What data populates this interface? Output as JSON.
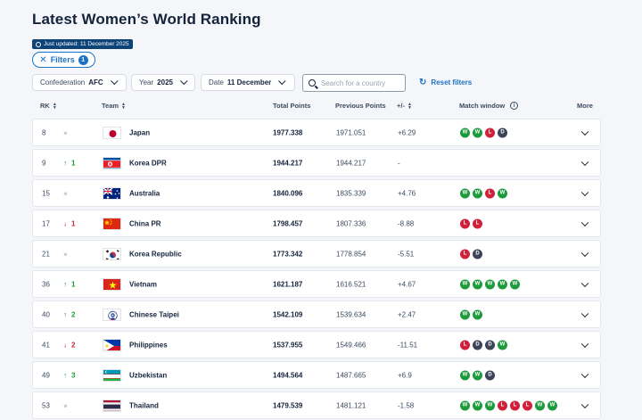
{
  "page": {
    "title": "Latest Women’s World Ranking",
    "updated": "Just updated: 11 December 2025"
  },
  "filters": {
    "label": "Filters",
    "count": "1",
    "close_glyph": "✕"
  },
  "dropdowns": {
    "confederation": {
      "label": "Confederation",
      "value": "AFC"
    },
    "year": {
      "label": "Year",
      "value": "2025"
    },
    "date": {
      "label": "Date",
      "value": "11 December"
    }
  },
  "search": {
    "placeholder": "Search for a country"
  },
  "reset": {
    "label": "Reset filters",
    "glyph": "↻"
  },
  "columns": {
    "rk": "RK",
    "team": "Team",
    "total": "Total Points",
    "previous": "Previous Points",
    "plusminus": "+/-",
    "match_window": "Match window",
    "more": "More",
    "info_glyph": "i"
  },
  "colors": {
    "win": "#1d9a3c",
    "loss": "#d0213a",
    "draw": "#3a4456",
    "accent": "#1a73c9"
  },
  "rows": [
    {
      "rk": "8",
      "move": "",
      "dir": "none",
      "team": "Japan",
      "flag": "japan",
      "total": "1977.338",
      "prev": "1971.051",
      "pm": "+6.29",
      "mw": [
        "W",
        "W",
        "L",
        "D"
      ]
    },
    {
      "rk": "9",
      "move": "1",
      "dir": "up",
      "team": "Korea DPR",
      "flag": "korea-dpr",
      "total": "1944.217",
      "prev": "1944.217",
      "pm": "-",
      "mw": []
    },
    {
      "rk": "15",
      "move": "",
      "dir": "none",
      "team": "Australia",
      "flag": "australia",
      "total": "1840.096",
      "prev": "1835.339",
      "pm": "+4.76",
      "mw": [
        "W",
        "W",
        "L",
        "W"
      ]
    },
    {
      "rk": "17",
      "move": "1",
      "dir": "down",
      "team": "China PR",
      "flag": "china",
      "total": "1798.457",
      "prev": "1807.336",
      "pm": "-8.88",
      "mw": [
        "L",
        "L"
      ]
    },
    {
      "rk": "21",
      "move": "",
      "dir": "none",
      "team": "Korea Republic",
      "flag": "korea-rep",
      "total": "1773.342",
      "prev": "1778.854",
      "pm": "-5.51",
      "mw": [
        "L",
        "D"
      ]
    },
    {
      "rk": "36",
      "move": "1",
      "dir": "up",
      "team": "Vietnam",
      "flag": "vietnam",
      "total": "1621.187",
      "prev": "1616.521",
      "pm": "+4.67",
      "mw": [
        "W",
        "W",
        "W",
        "W",
        "W"
      ]
    },
    {
      "rk": "40",
      "move": "2",
      "dir": "up",
      "team": "Chinese Taipei",
      "flag": "taipei",
      "total": "1542.109",
      "prev": "1539.634",
      "pm": "+2.47",
      "mw": [
        "W",
        "W"
      ]
    },
    {
      "rk": "41",
      "move": "2",
      "dir": "down",
      "team": "Philippines",
      "flag": "philippines",
      "total": "1537.955",
      "prev": "1549.466",
      "pm": "-11.51",
      "mw": [
        "L",
        "D",
        "D",
        "W"
      ]
    },
    {
      "rk": "49",
      "move": "3",
      "dir": "up",
      "team": "Uzbekistan",
      "flag": "uzbekistan",
      "total": "1494.564",
      "prev": "1487.665",
      "pm": "+6.9",
      "mw": [
        "W",
        "W",
        "D"
      ]
    },
    {
      "rk": "53",
      "move": "",
      "dir": "none",
      "team": "Thailand",
      "flag": "thailand",
      "total": "1479.539",
      "prev": "1481.121",
      "pm": "-1.58",
      "mw": [
        "W",
        "W",
        "W",
        "L",
        "L",
        "L",
        "W",
        "W"
      ]
    }
  ]
}
